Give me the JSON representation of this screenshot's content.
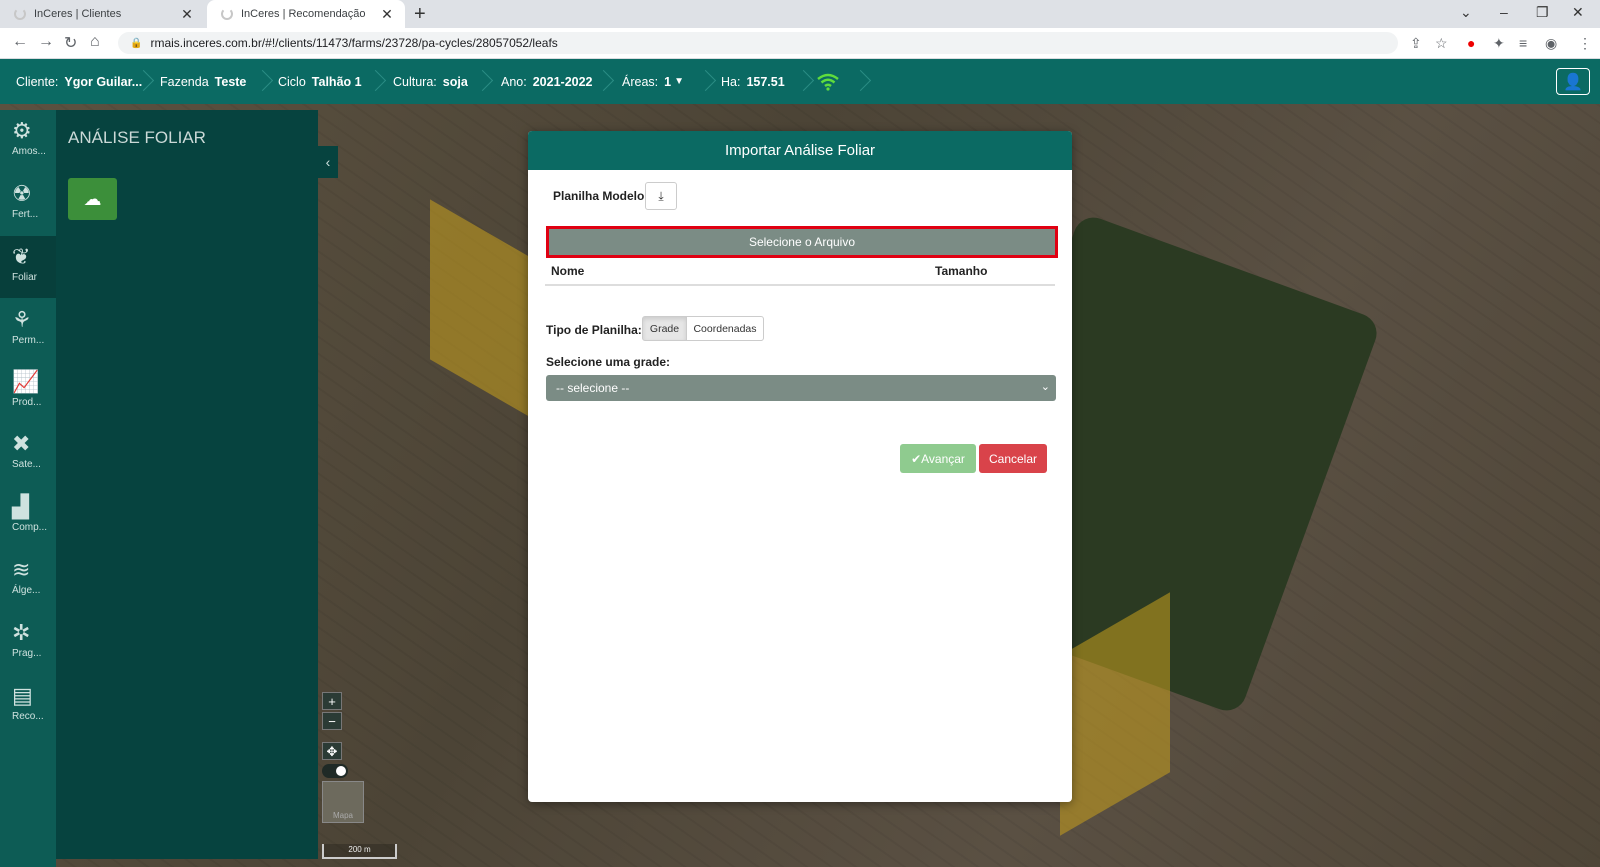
{
  "browser": {
    "tabs": [
      {
        "title": "InCeres | Clientes"
      },
      {
        "title": "InCeres | Recomendação"
      }
    ],
    "url": "rmais.inceres.com.br/#!/clients/11473/farms/23728/pa-cycles/28057052/leafs"
  },
  "topnav": {
    "cliente_label": "Cliente:",
    "cliente": "Ygor Guilar...",
    "fazenda_label": "Fazenda",
    "fazenda": "Teste",
    "ciclo_label": "Ciclo",
    "ciclo": "Talhão 1",
    "cultura_label": "Cultura:",
    "cultura": "soja",
    "ano_label": "Ano:",
    "ano": "2021-2022",
    "areas_label": "Áreas:",
    "areas": "1",
    "ha_label": "Ha:",
    "ha": "157.51"
  },
  "sidebar": {
    "items": [
      {
        "label": "Amos...",
        "icon": "sampling-icon"
      },
      {
        "label": "Fert...",
        "icon": "fertility-icon"
      },
      {
        "label": "Foliar",
        "icon": "leaf-icon"
      },
      {
        "label": "Perm...",
        "icon": "permission-icon"
      },
      {
        "label": "Prod...",
        "icon": "productivity-icon"
      },
      {
        "label": "Sate...",
        "icon": "satellite-icon"
      },
      {
        "label": "Comp...",
        "icon": "compare-icon"
      },
      {
        "label": "Álge...",
        "icon": "layers-icon"
      },
      {
        "label": "Prag...",
        "icon": "pest-icon"
      },
      {
        "label": "Reco...",
        "icon": "recommendation-icon"
      }
    ]
  },
  "panel": {
    "title": "ANÁLISE FOLIAR"
  },
  "map": {
    "minimap_label": "Mapa",
    "scale": "200 m"
  },
  "modal": {
    "title": "Importar Análise Foliar",
    "planilha_modelo": "Planilha Modelo",
    "select_file": "Selecione o Arquivo",
    "col_nome": "Nome",
    "col_tamanho": "Tamanho",
    "tipo_label": "Tipo de Planilha:",
    "tipo_options": [
      "Grade",
      "Coordenadas"
    ],
    "tipo_selected": "Grade",
    "grade_label": "Selecione uma grade:",
    "grade_value": "-- selecione --",
    "avancar": "Avançar",
    "cancelar": "Cancelar"
  },
  "colors": {
    "primary": "#0b6a63",
    "sidebar": "#0d5c55",
    "panel": "#06433f",
    "highlight": "#e00012",
    "success": "#8fcb8f",
    "danger": "#d9434a"
  }
}
